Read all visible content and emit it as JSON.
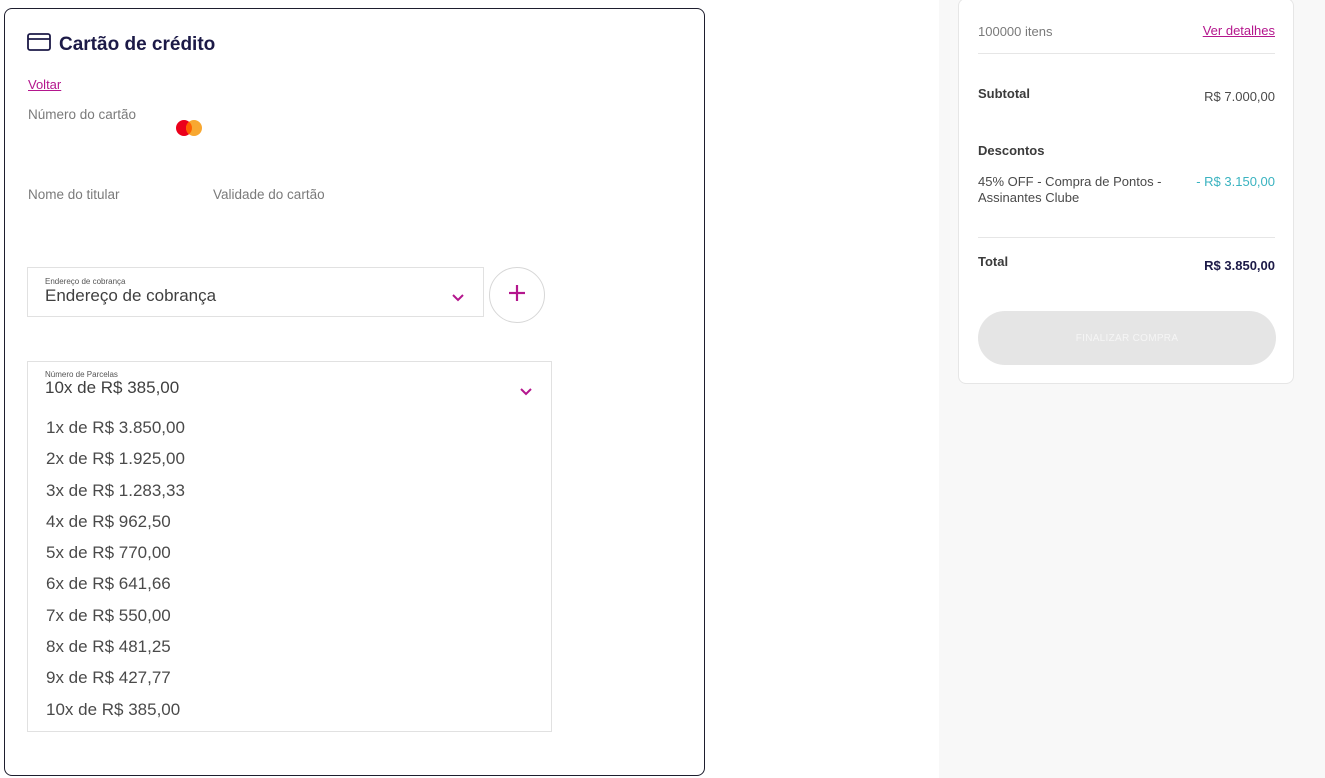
{
  "payment": {
    "title": "Cartão de crédito",
    "back_link": "Voltar",
    "card_number_label": "Número do cartão",
    "card_holder_label": "Nome do titular",
    "card_expiry_label": "Validade do cartão",
    "billing_address": {
      "small_label": "Endereço de cobrança",
      "value": "Endereço de cobrança"
    },
    "installments": {
      "small_label": "Número de Parcelas",
      "selected": "10x de R$ 385,00",
      "options": [
        "1x de R$ 3.850,00",
        "2x de R$ 1.925,00",
        "3x de R$ 1.283,33",
        "4x de R$ 962,50",
        "5x de R$ 770,00",
        "6x de R$ 641,66",
        "7x de R$ 550,00",
        "8x de R$ 481,25",
        "9x de R$ 427,77",
        "10x de R$ 385,00"
      ]
    }
  },
  "summary": {
    "items_count": "100000 itens",
    "details_link": "Ver detalhes",
    "subtotal_label": "Subtotal",
    "subtotal_value": "R$ 7.000,00",
    "discounts_label": "Descontos",
    "discount_description": "45% OFF - Compra de Pontos - Assinantes Clube",
    "discount_value": "- R$ 3.150,00",
    "total_label": "Total",
    "total_value": "R$ 3.850,00",
    "finish_button": "FINALIZAR COMPRA"
  },
  "colors": {
    "accent": "#b4168d",
    "title": "#1c1a47",
    "discount": "#3ab3c0",
    "disabled_button": "#e5e5e5"
  },
  "icons": {
    "title_icon": "credit-card-icon",
    "card_brand": "mastercard-icon",
    "dropdown": "chevron-down-icon",
    "add": "plus-icon"
  }
}
